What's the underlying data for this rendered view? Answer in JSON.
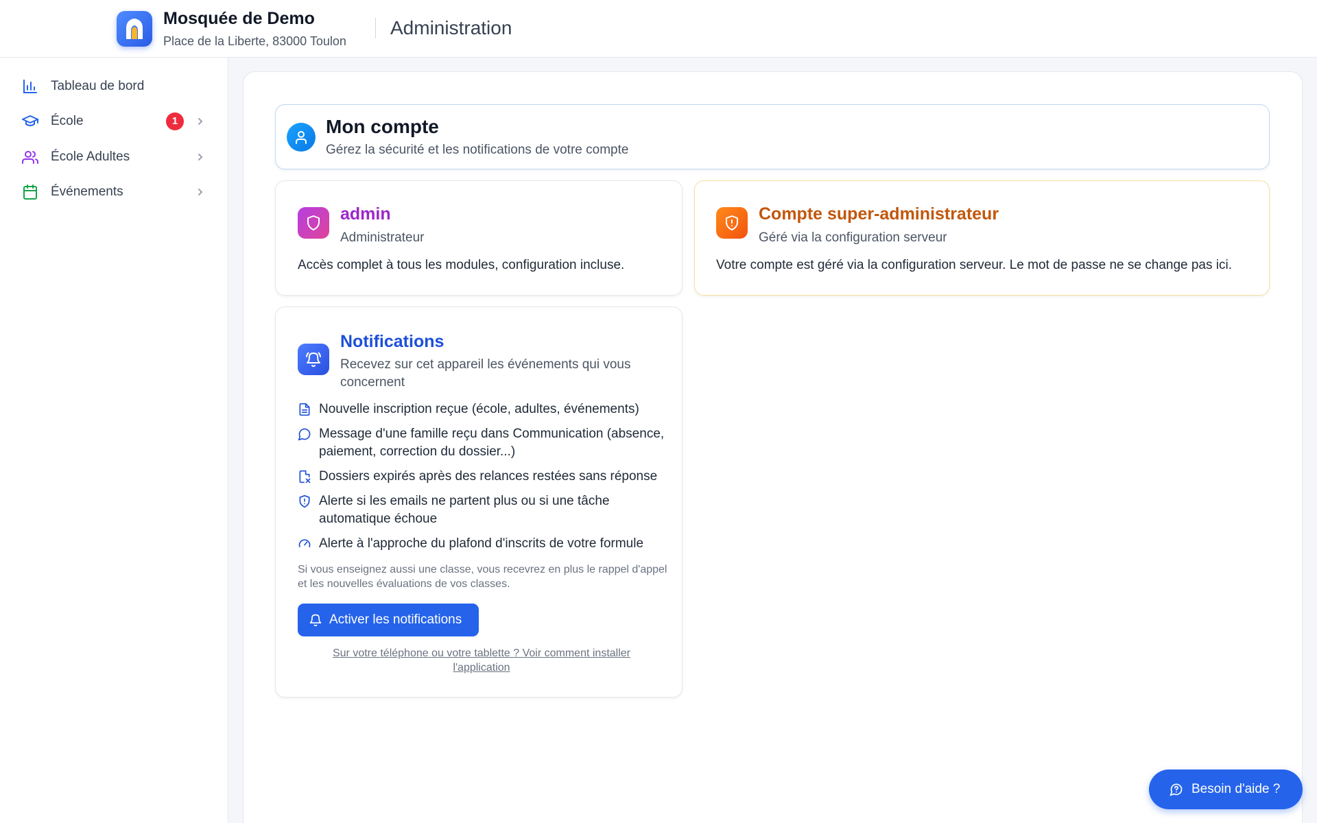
{
  "header": {
    "org_name": "Mosquée de Demo",
    "org_address": "Place de la Liberte, 83000 Toulon",
    "section_title": "Administration",
    "logo_icon": "mosque-arch-icon"
  },
  "sidebar": {
    "items": [
      {
        "label": "Tableau de bord",
        "icon": "bar-chart-icon",
        "color": "#2563eb"
      },
      {
        "label": "École",
        "icon": "graduation-cap-icon",
        "color": "#2563eb",
        "badge": "1"
      },
      {
        "label": "École Adultes",
        "icon": "users-icon",
        "color": "#9333ea"
      },
      {
        "label": "Événements",
        "icon": "calendar-icon",
        "color": "#16a34a"
      }
    ]
  },
  "account": {
    "title": "Mon compte",
    "subtitle": "Gérez la sécurité et les notifications de votre compte"
  },
  "admin_card": {
    "name": "admin",
    "role": "Administrateur",
    "description": "Accès complet à tous les modules, configuration incluse.",
    "accent": "#9b27c9"
  },
  "super_card": {
    "title": "Compte super-administrateur",
    "subtitle": "Géré via la configuration serveur",
    "description": "Votre compte est géré via la configuration serveur. Le mot de passe ne se change pas ici.",
    "accent": "#c2570c"
  },
  "notifications": {
    "title": "Notifications",
    "subtitle": "Recevez sur cet appareil les événements qui vous concernent",
    "items": [
      {
        "icon": "file-text-icon",
        "text": "Nouvelle inscription reçue (école, adultes, événements)"
      },
      {
        "icon": "message-circle-icon",
        "text": "Message d'une famille reçu dans Communication (absence, paiement, correction du dossier...)"
      },
      {
        "icon": "file-x-icon",
        "text": "Dossiers expirés après des relances restées sans réponse"
      },
      {
        "icon": "shield-alert-icon",
        "text": "Alerte si les emails ne partent plus ou si une tâche automatique échoue"
      },
      {
        "icon": "gauge-icon",
        "text": "Alerte à l'approche du plafond d'inscrits de votre formule"
      }
    ],
    "note": "Si vous enseignez aussi une classe, vous recevrez en plus le rappel d'appel et les nouvelles évaluations de vos classes.",
    "button_label": "Activer les notifications",
    "install_link": "Sur votre téléphone ou votre tablette ? Voir comment installer l'application",
    "accent": "#1d4fd8"
  },
  "help": {
    "label": "Besoin d'aide ?"
  }
}
